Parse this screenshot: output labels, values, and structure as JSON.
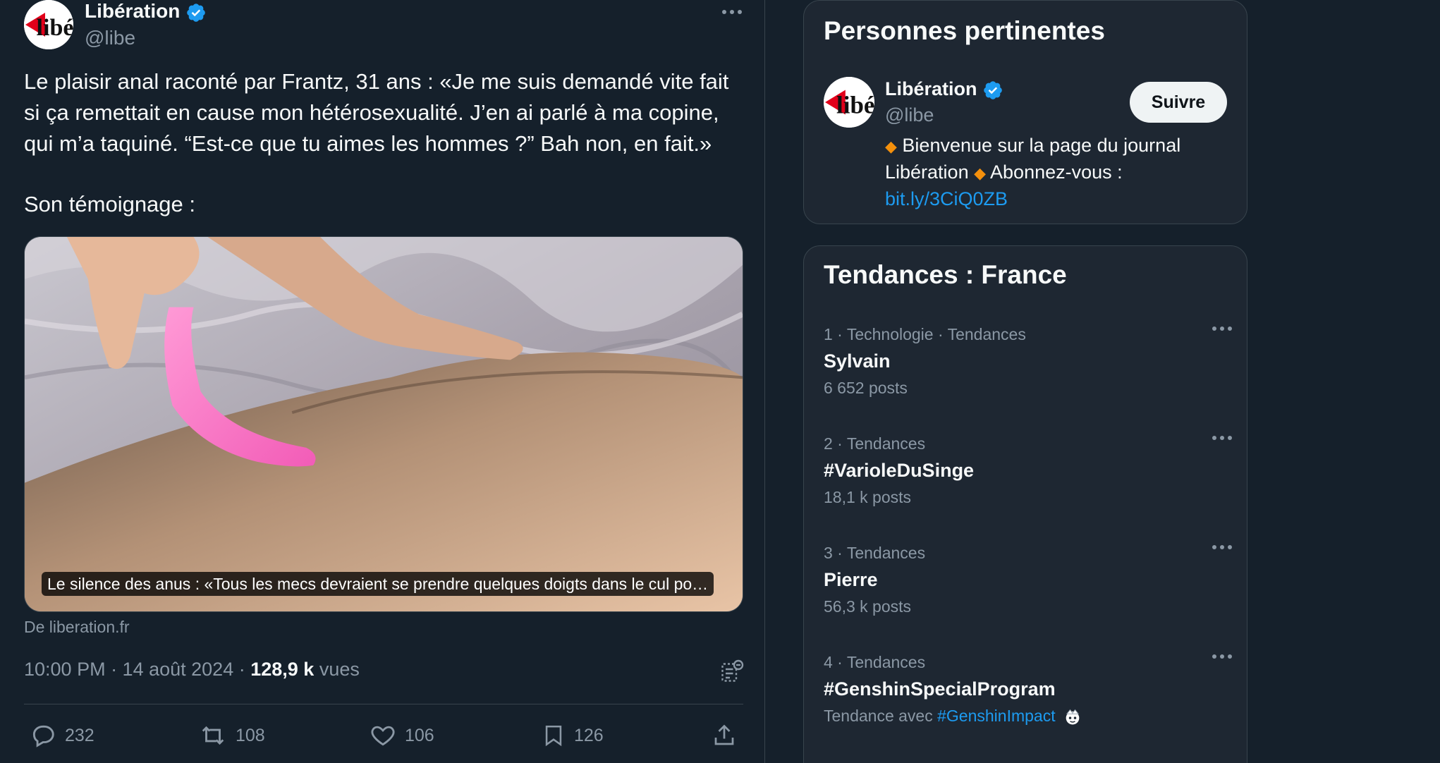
{
  "tweet": {
    "author_name": "Libération",
    "author_handle": "@libe",
    "text_lines": [
      "Le plaisir anal raconté par Frantz, 31 ans : «Je me suis demandé vite fait",
      "si ça remettait en cause mon hétérosexualité. J’en ai parlé à ma copine,",
      "qui m’a taquiné. “Est-ce que tu aimes les hommes ?” Bah non, en fait.»"
    ],
    "text_tail": "Son témoignage :",
    "card_caption": "Le silence des anus : «Tous les mecs devraient se prendre quelques doigts dans le cul po…",
    "source": "De liberation.fr",
    "timestamp": "10:00 PM · 14 août 2024 · ",
    "views_count": "128,9 k",
    "views_label": " vues",
    "actions": {
      "replies": "232",
      "retweets": "108",
      "likes": "106",
      "bookmarks": "126"
    }
  },
  "relevant_people": {
    "title": "Personnes pertinentes",
    "name": "Libération",
    "handle": "@libe",
    "follow_label": "Suivre",
    "bio_part1": " Bienvenue sur la page du journal",
    "bio_part2": "Libération ",
    "bio_part3": " Abonnez-vous :",
    "bio_link": "bit.ly/3CiQ0ZB",
    "bio_bullet": "◆"
  },
  "trends": {
    "title": "Tendances : France",
    "items": [
      {
        "meta": "1 · Technologie · Tendances",
        "name": "Sylvain",
        "count": "6 652 posts"
      },
      {
        "meta": "2 · Tendances",
        "name": "#VarioleDuSinge",
        "count": "18,1 k posts"
      },
      {
        "meta": "3 · Tendances",
        "name": "Pierre",
        "count": "56,3 k posts"
      },
      {
        "meta": "4 · Tendances",
        "name": "#GenshinSpecialProgram",
        "count_prefix": "Tendance avec ",
        "count_link": "#GenshinImpact"
      }
    ]
  },
  "colors": {
    "background": "#15202b",
    "card": "#1e2732",
    "accent": "#1d9bf0",
    "muted": "#8b98a5",
    "verified": "#1d9bf0",
    "bullet": "#f4900c"
  },
  "icons": {
    "verified": "verified-badge-icon",
    "more": "more-horizontal-icon",
    "reply": "reply-icon",
    "retweet": "retweet-icon",
    "like": "heart-icon",
    "bookmark": "bookmark-icon",
    "share": "share-icon",
    "analytics": "analytics-icon"
  }
}
